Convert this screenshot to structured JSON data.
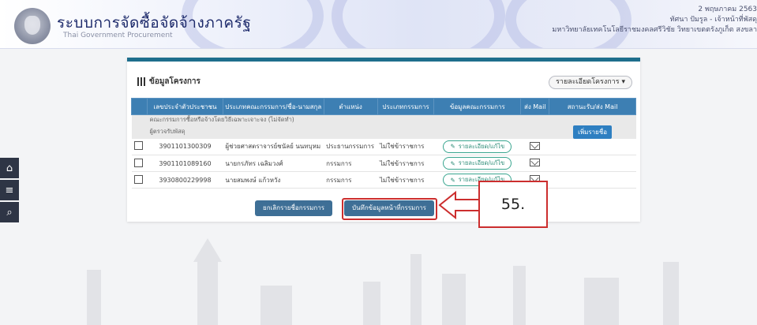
{
  "header": {
    "title": "ระบบการจัดซื้อจัดจ้างภาครัฐ",
    "subtitle": "Thai Government Procurement",
    "date": "2 พฤษภาคม 2563",
    "user": "ทัศนา ปัมรูล - เจ้าหน้าที่พัสดุ",
    "agency": "มหาวิทยาลัยเทคโนโลยีราชมงคลศรีวิชัย วิทยาเขตตรังภูเก็ต สงขลา"
  },
  "sidebar": {
    "home_icon": "home-icon",
    "menu_icon": "menu-icon",
    "search_icon": "search-icon"
  },
  "panel": {
    "title": "ข้อมูลโครงการ",
    "detail_button": "รายละเอียดโครงการ ▾",
    "columns": [
      "",
      "เลขประจำตัวประชาชน",
      "ประเภทคณะกรรมการ/ชื่อ-นามสกุล",
      "ตำแหน่ง",
      "ประเภทกรรมการ",
      "ข้อมูลคณะกรรมการ",
      "ส่ง Mail",
      "สถานะรับ/ส่ง Mail"
    ],
    "group_label": "คณะกรรมการซื้อหรือจ้างโดยวิธีเฉพาะเจาะจง (ไม่จัดทำ)",
    "responsible_label": "ผู้ตรวจรับพัสดุ",
    "add_button": "เพิ่มรายชื่อ",
    "rows": [
      {
        "id": "3901101300309",
        "name": "ผู้ช่วยศาสตราจารย์ชนัลย์ นนทบุหม",
        "position": "ประธานกรรมการ",
        "type": "ไม่ใช่ข้าราชการ",
        "action": "รายละเอียด/แก้ไข"
      },
      {
        "id": "3901101089160",
        "name": "นายกรภัทร เฉลิมวงศ์",
        "position": "กรรมการ",
        "type": "ไม่ใช่ข้าราชการ",
        "action": "รายละเอียด/แก้ไข"
      },
      {
        "id": "3930800229998",
        "name": "นายสมพงษ์ แก้วหวัง",
        "position": "กรรมการ",
        "type": "ไม่ใช่ข้าราชการ",
        "action": "รายละเอียด/แก้ไข"
      }
    ],
    "cancel_button": "ยกเลิกรายชื่อกรรมการ",
    "save_button": "บันทึกข้อมูลหน้าที่กรรมการ"
  },
  "annotation": {
    "step": "55."
  }
}
